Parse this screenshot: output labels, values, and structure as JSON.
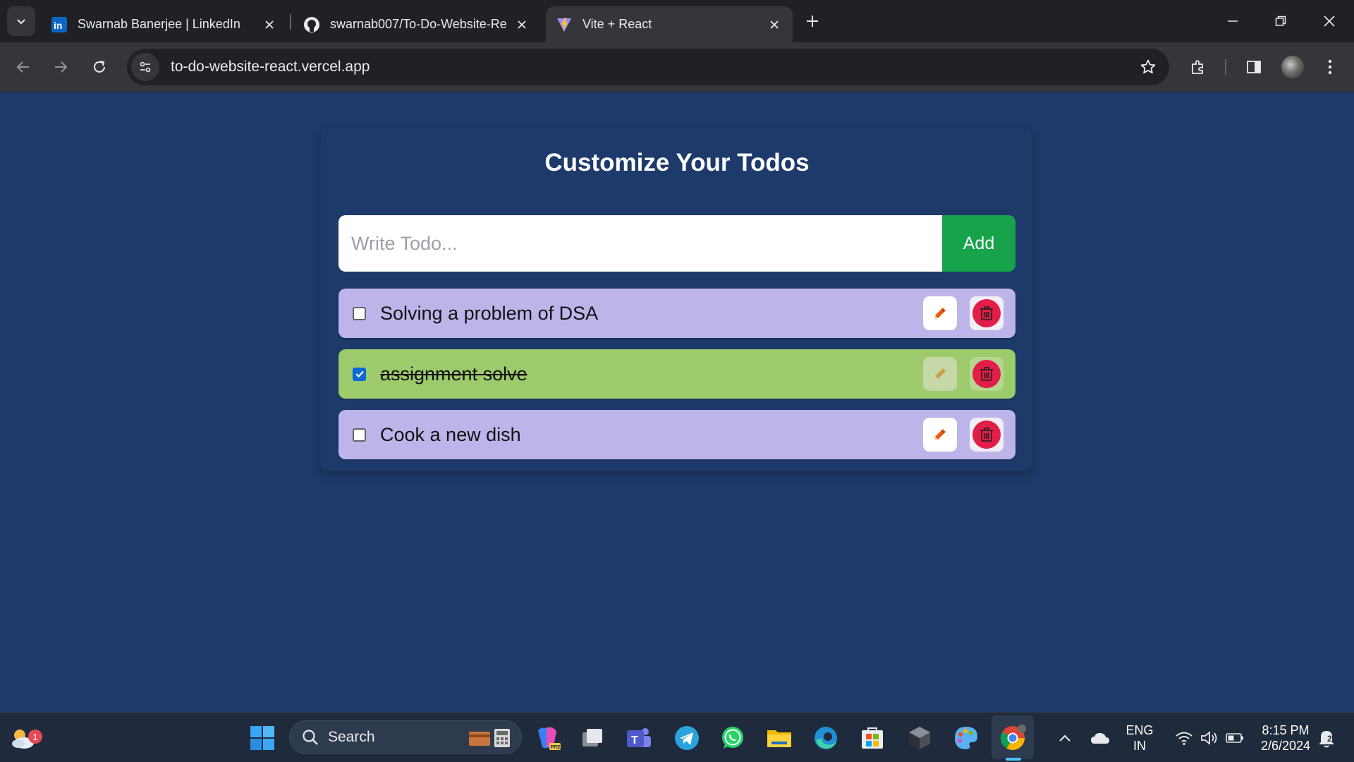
{
  "browser": {
    "tabs": [
      {
        "title": "Swarnab Banerjee | LinkedIn",
        "favicon": "linkedin-icon",
        "active": false
      },
      {
        "title": "swarnab007/To-Do-Website-Re",
        "favicon": "github-icon",
        "active": false
      },
      {
        "title": "Vite + React",
        "favicon": "vite-icon",
        "active": true
      }
    ],
    "url": "to-do-website-react.vercel.app"
  },
  "app": {
    "heading": "Customize Your Todos",
    "input_placeholder": "Write Todo...",
    "add_label": "Add",
    "todos": [
      {
        "text": "Solving a problem of DSA",
        "completed": false
      },
      {
        "text": "assignment solve",
        "completed": true
      },
      {
        "text": "Cook a new dish",
        "completed": false
      }
    ]
  },
  "colors": {
    "page_background": "#1e3a6a",
    "todo_pending": "#bdb5ea",
    "todo_done": "#9dcb6c",
    "add_button": "#16a34a",
    "delete": "#e11d48",
    "edit_icon": "#ea580c"
  },
  "taskbar": {
    "weather_badge": "1",
    "search_label": "Search",
    "language_line1": "ENG",
    "language_line2": "IN",
    "time": "8:15 PM",
    "date": "2/6/2024",
    "notification_count": "2"
  }
}
